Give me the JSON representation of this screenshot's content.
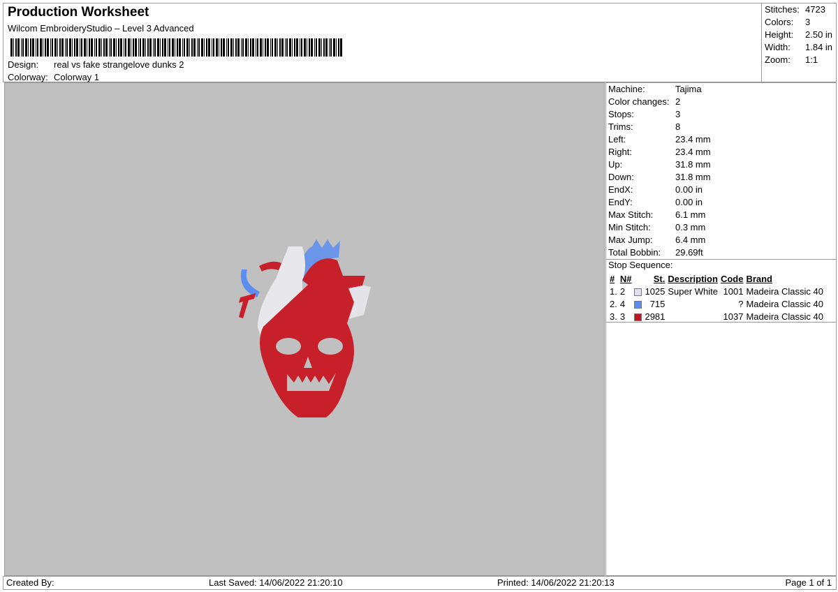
{
  "header": {
    "title": "Production Worksheet",
    "subtitle": "Wilcom EmbroideryStudio – Level 3 Advanced",
    "design_label": "Design:",
    "design": "real vs fake strangelove dunks 2",
    "colorway_label": "Colorway:",
    "colorway": "Colorway 1"
  },
  "stats": [
    {
      "k": "Stitches:",
      "v": "4723"
    },
    {
      "k": "Colors:",
      "v": "3"
    },
    {
      "k": "Height:",
      "v": "2.50 in"
    },
    {
      "k": "Width:",
      "v": "1.84 in"
    },
    {
      "k": "Zoom:",
      "v": "1:1"
    }
  ],
  "specs": [
    {
      "k": "Machine:",
      "v": "Tajima"
    },
    {
      "k": "Color changes:",
      "v": "2"
    },
    {
      "k": "Stops:",
      "v": "3"
    },
    {
      "k": "Trims:",
      "v": "8"
    },
    {
      "k": "Left:",
      "v": "23.4 mm"
    },
    {
      "k": "Right:",
      "v": "23.4 mm"
    },
    {
      "k": "Up:",
      "v": "31.8 mm"
    },
    {
      "k": "Down:",
      "v": "31.8 mm"
    },
    {
      "k": "EndX:",
      "v": "0.00 in"
    },
    {
      "k": "EndY:",
      "v": "0.00 in"
    },
    {
      "k": "Max Stitch:",
      "v": "6.1 mm"
    },
    {
      "k": "Min Stitch:",
      "v": "0.3 mm"
    },
    {
      "k": "Max Jump:",
      "v": "6.4 mm"
    },
    {
      "k": "Total Bobbin:",
      "v": "29.69ft"
    }
  ],
  "stop_sequence": {
    "title": "Stop Sequence:",
    "headers": [
      "#",
      "N#",
      "St.",
      "Description",
      "Code",
      "Brand"
    ],
    "rows": [
      {
        "num": "1.",
        "n": "2",
        "color": "#e0e0f0",
        "st": "1025",
        "desc": "Super White",
        "code": "1001",
        "brand": "Madeira Classic 40"
      },
      {
        "num": "2.",
        "n": "4",
        "color": "#5b8ef0",
        "st": "715",
        "desc": "",
        "code": "?",
        "brand": "Madeira Classic 40"
      },
      {
        "num": "3.",
        "n": "3",
        "color": "#c0141e",
        "st": "2981",
        "desc": "",
        "code": "1037",
        "brand": "Madeira Classic 40"
      }
    ]
  },
  "footer": {
    "created": "Created By:",
    "saved": "Last Saved: 14/06/2022 21:20:10",
    "printed": "Printed: 14/06/2022 21:20:13",
    "page": "Page 1 of 1"
  }
}
